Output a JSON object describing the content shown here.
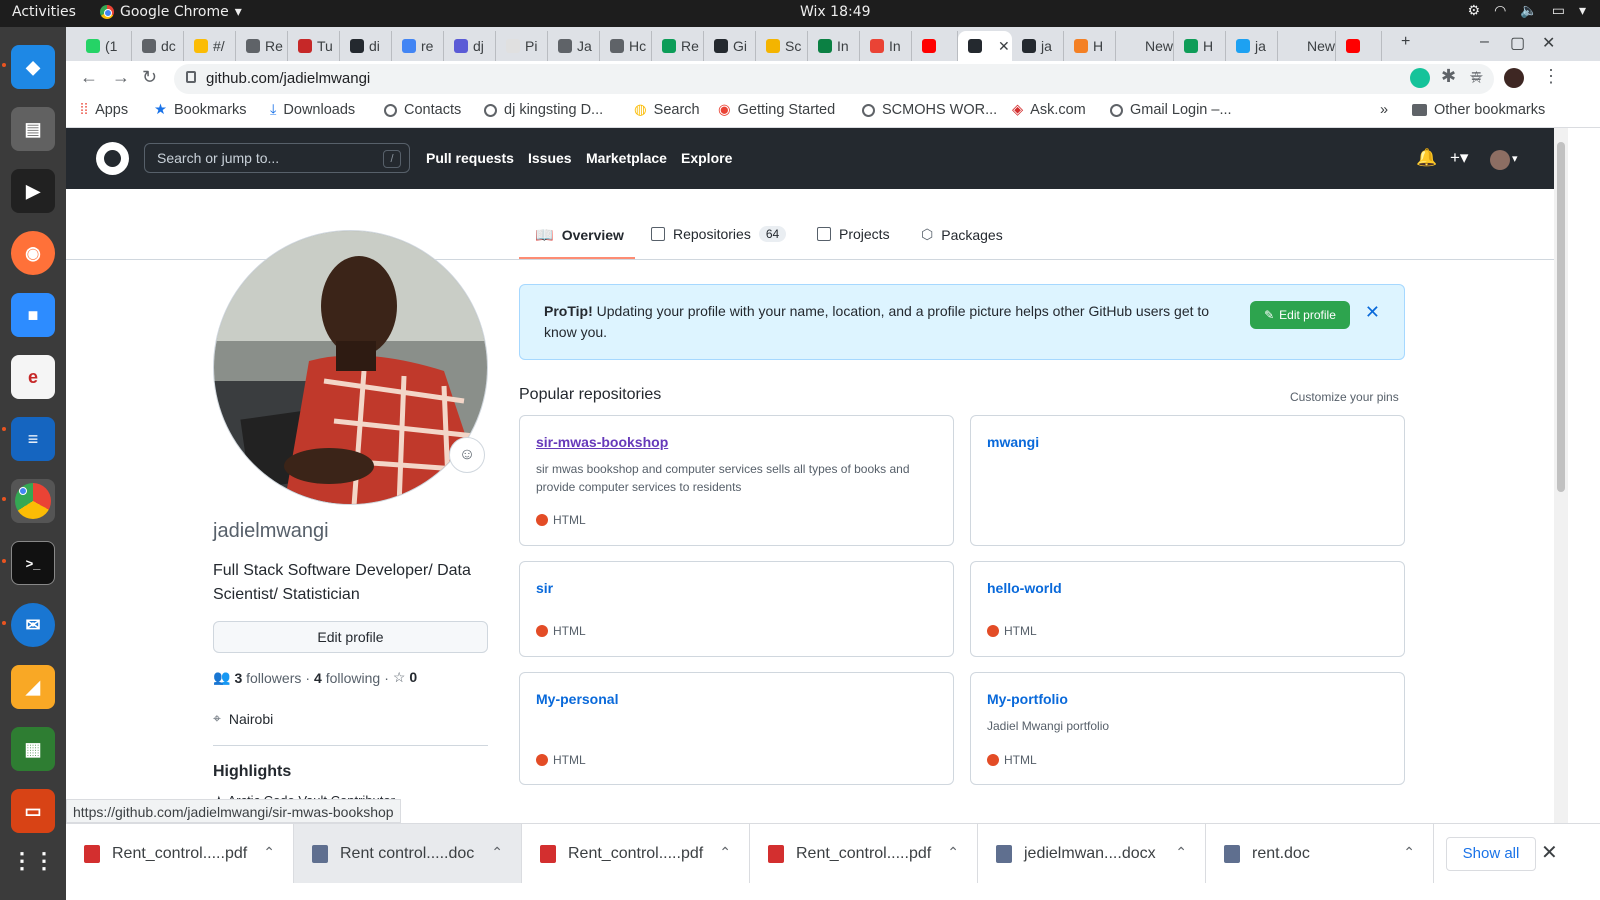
{
  "os_bar": {
    "activities": "Activities",
    "app_name": "Google Chrome",
    "clock": "Wix 18:49"
  },
  "tabs": [
    {
      "label": "(1",
      "color": "#25d366"
    },
    {
      "label": "dc",
      "color": "#5f6368"
    },
    {
      "label": "#/",
      "color": "#fbbc05"
    },
    {
      "label": "Re",
      "color": "#5f6368"
    },
    {
      "label": "Tu",
      "color": "#c62828"
    },
    {
      "label": "di",
      "color": "#24292f"
    },
    {
      "label": "re",
      "color": "#4285f4"
    },
    {
      "label": "dj",
      "color": "#5b5bd6"
    },
    {
      "label": "Pi",
      "color": "#e0e0e0"
    },
    {
      "label": "Ja",
      "color": "#5f6368"
    },
    {
      "label": "Hc",
      "color": "#5f6368"
    },
    {
      "label": "Re",
      "color": "#0c9d58"
    },
    {
      "label": "Gi",
      "color": "#24292f"
    },
    {
      "label": "Sc",
      "color": "#f4b400"
    },
    {
      "label": "In",
      "color": "#0b8043"
    },
    {
      "label": "In",
      "color": "#ea4335"
    },
    {
      "label": "",
      "color": "#ff0000"
    },
    {
      "label": "",
      "color": "#24292f",
      "active": true
    },
    {
      "label": "ja",
      "color": "#24292f"
    },
    {
      "label": "H",
      "color": "#f48024"
    },
    {
      "label": "New",
      "color": "#dee1e6"
    },
    {
      "label": "H",
      "color": "#0f9d58"
    },
    {
      "label": "ja",
      "color": "#1da1f2"
    },
    {
      "label": "New",
      "color": "#dee1e6"
    },
    {
      "label": "",
      "color": "#ff0000"
    }
  ],
  "address_bar": {
    "url": "github.com/jadielmwangi"
  },
  "bookmarks": [
    {
      "label": "Apps",
      "icon": "apps-grid-icon"
    },
    {
      "label": "Bookmarks",
      "icon": "star-icon"
    },
    {
      "label": "Downloads",
      "icon": "download-icon"
    },
    {
      "label": "Contacts",
      "icon": "globe-icon"
    },
    {
      "label": "dj kingsting D...",
      "icon": "globe-icon"
    },
    {
      "label": "Search",
      "icon": "search-icon"
    },
    {
      "label": "Getting Started",
      "icon": "chrome-icon"
    },
    {
      "label": "SCMOHS WOR...",
      "icon": "globe-icon"
    },
    {
      "label": "Ask.com",
      "icon": "ask-icon"
    },
    {
      "label": "Gmail Login –...",
      "icon": "globe-icon"
    }
  ],
  "bookmarks_more": "»",
  "other_bookmarks": "Other bookmarks",
  "github_header": {
    "search_placeholder": "Search or jump to...",
    "search_shortcut": "/",
    "nav": [
      "Pull requests",
      "Issues",
      "Marketplace",
      "Explore"
    ]
  },
  "profile_tabs": [
    {
      "label": "Overview",
      "active": true
    },
    {
      "label": "Repositories",
      "counter": "64"
    },
    {
      "label": "Projects"
    },
    {
      "label": "Packages"
    }
  ],
  "profile": {
    "username": "jadielmwangi",
    "bio": "Full Stack Software Developer/ Data Scientist/ Statistician",
    "edit_button": "Edit profile",
    "followers_count": "3",
    "followers_label": "followers",
    "following_count": "4",
    "following_label": "following",
    "stars_count": "0",
    "location": "Nairobi",
    "highlights_title": "Highlights",
    "highlights_item": "Arctic Code Vault Contributor"
  },
  "protip": {
    "bold": "ProTip!",
    "text": "Updating your profile with your name, location, and a profile picture helps other GitHub users get to know you.",
    "button": "Edit profile"
  },
  "popular": {
    "title": "Popular repositories",
    "customize": "Customize your pins",
    "repos": [
      {
        "name": "sir-mwas-bookshop",
        "description": "sir mwas bookshop and computer services sells all types of books and provide computer services to residents",
        "language": "HTML",
        "lang_color": "#e34c26"
      },
      {
        "name": "mwangi",
        "description": "",
        "language": "",
        "lang_color": "#e34c26"
      },
      {
        "name": "sir",
        "description": "",
        "language": "HTML",
        "lang_color": "#e34c26"
      },
      {
        "name": "hello-world",
        "description": "",
        "language": "HTML",
        "lang_color": "#e34c26"
      },
      {
        "name": "My-personal",
        "description": "",
        "language": "HTML",
        "lang_color": "#e34c26"
      },
      {
        "name": "My-portfolio",
        "description": "Jadiel Mwangi portfolio",
        "language": "HTML",
        "lang_color": "#e34c26"
      }
    ]
  },
  "status_url": "https://github.com/jadielmwangi/sir-mwas-bookshop",
  "downloads": [
    {
      "name": "Rent_control.....pdf",
      "type": "pdf"
    },
    {
      "name": "Rent control.....doc",
      "type": "doc"
    },
    {
      "name": "Rent_control.....pdf",
      "type": "pdf"
    },
    {
      "name": "Rent_control.....pdf",
      "type": "pdf"
    },
    {
      "name": "jedielmwan....docx",
      "type": "doc"
    },
    {
      "name": "rent.doc",
      "type": "doc"
    }
  ],
  "show_all": "Show all",
  "colors": {
    "github_dark": "#24292f",
    "link_blue": "#0969da",
    "green_button": "#2da44e",
    "html_lang": "#e34c26",
    "tab_underline": "#fd8c73"
  }
}
